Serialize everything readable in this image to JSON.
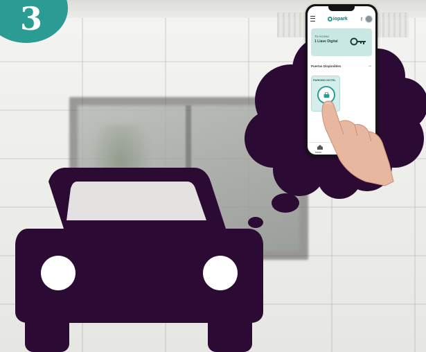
{
  "step": {
    "number": "3"
  },
  "colors": {
    "teal": "#2a9c94",
    "plum": "#2b0a33"
  },
  "app": {
    "logo_text": "iopark",
    "access": {
      "label": "Tu Acceso",
      "value": "1 Llave Digital"
    },
    "section_title": "Puertas Disponibles",
    "section_arrow": "→",
    "door": {
      "name": "PARKING HOTEL"
    },
    "nav": {
      "home_label": "Inicio"
    }
  },
  "icons": [
    "menu-icon",
    "key-icon",
    "lock-icon",
    "home-icon",
    "avatar"
  ]
}
